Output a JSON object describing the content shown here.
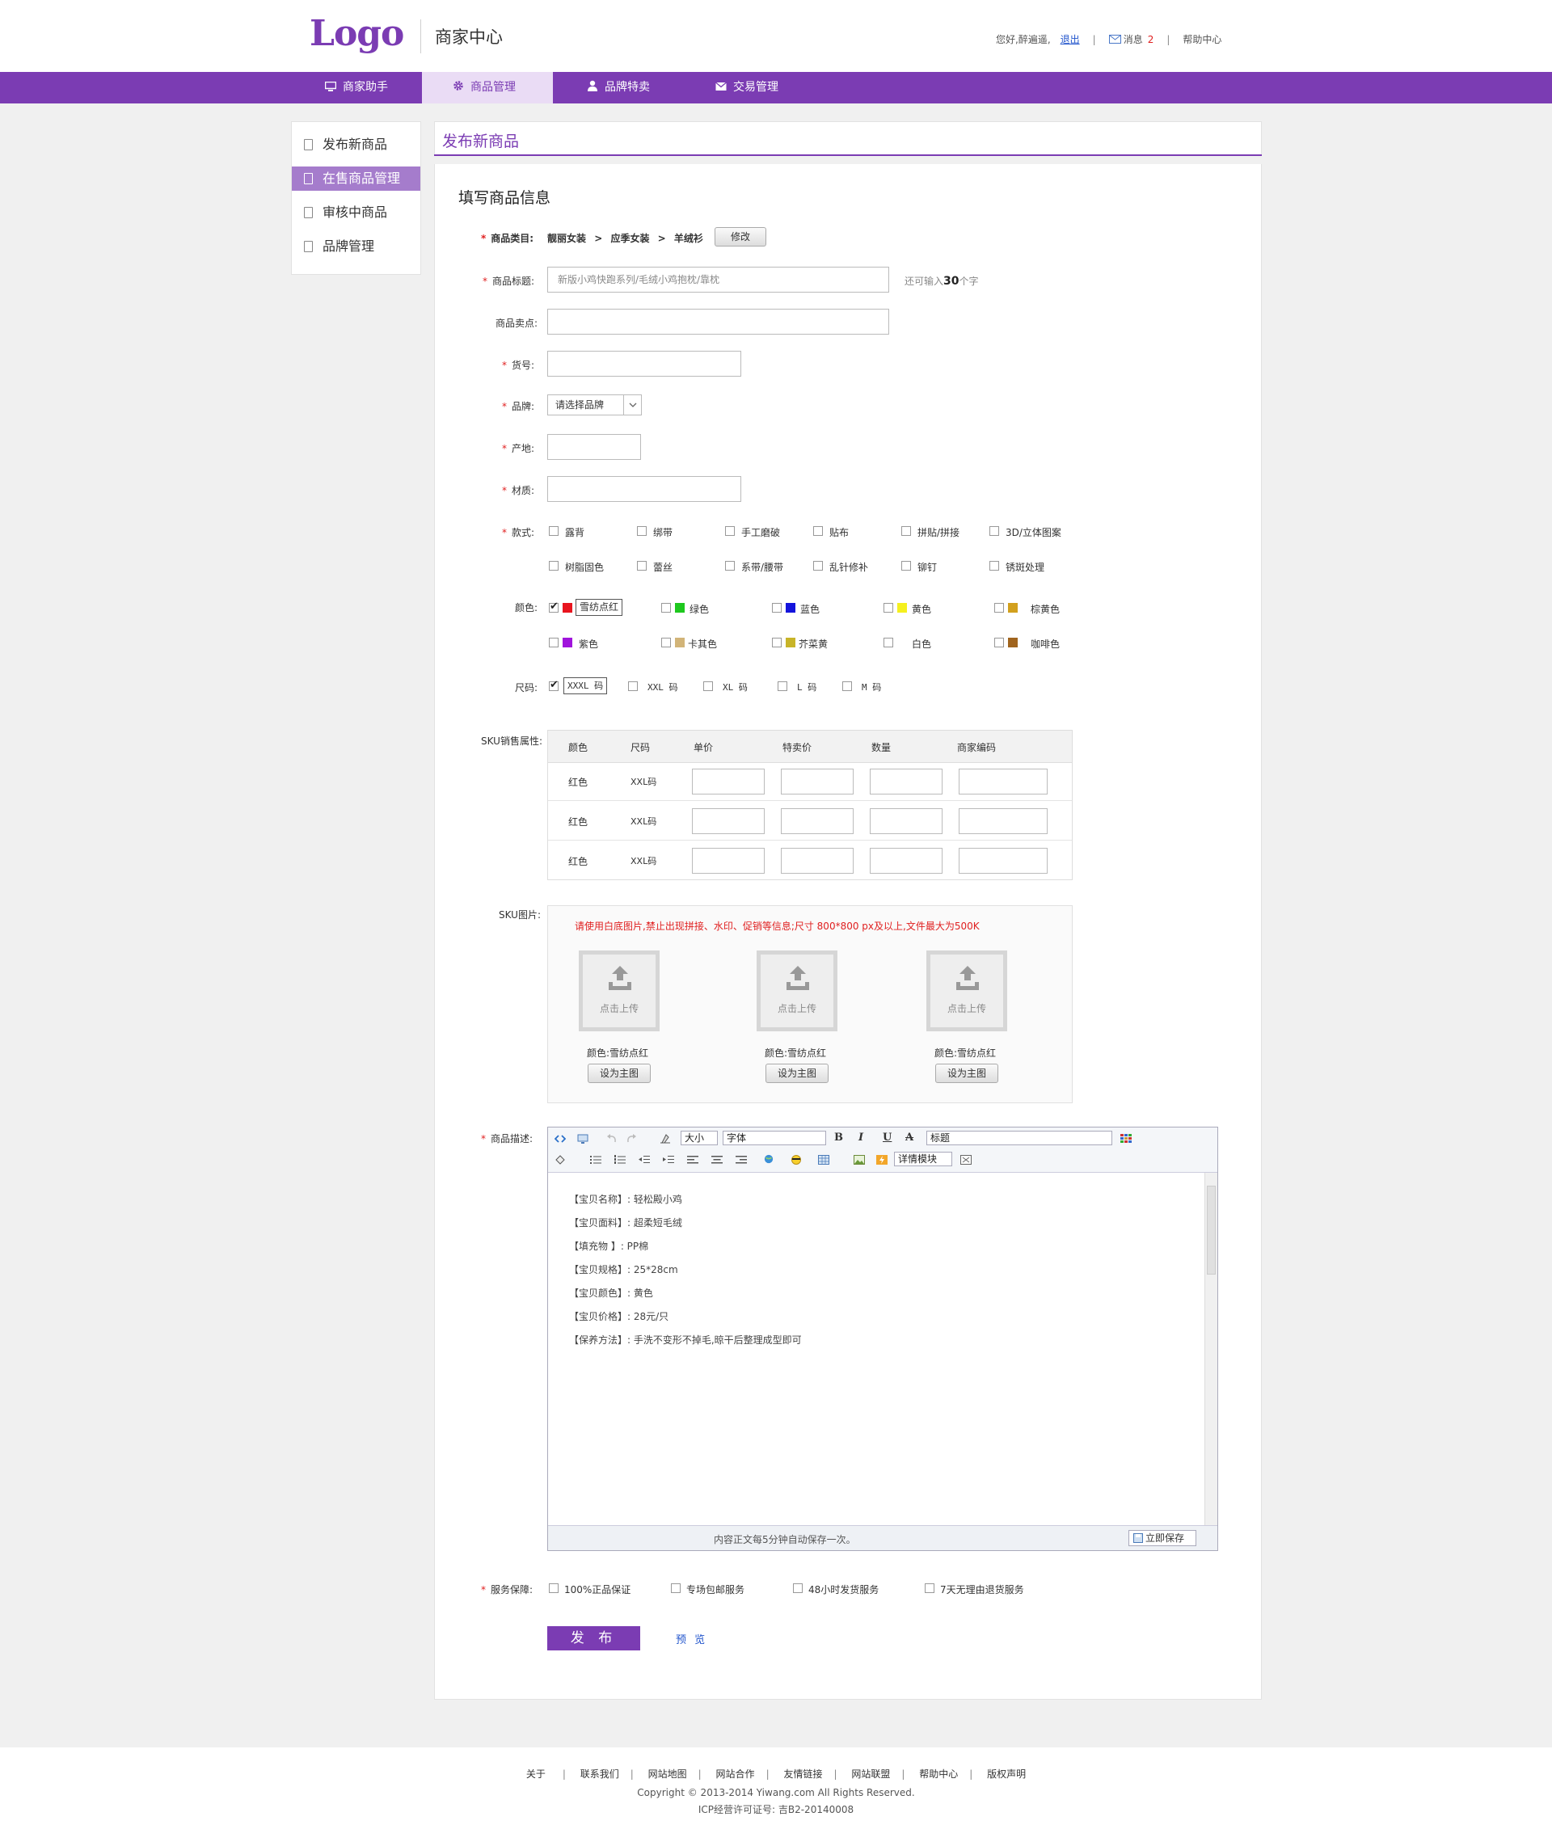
{
  "brand": {
    "logo": "Logo",
    "site_name": "商家中心"
  },
  "topbar": {
    "greeting": "您好,醉遍遥,",
    "logout": "退出",
    "messages_label": "消息",
    "messages_count": "2",
    "help": "帮助中心",
    "separator": "|"
  },
  "nav": {
    "items": [
      {
        "label": "商家助手",
        "icon": "monitor-icon"
      },
      {
        "label": "商品管理",
        "icon": "gear-icon"
      },
      {
        "label": "品牌特卖",
        "icon": "user-icon"
      },
      {
        "label": "交易管理",
        "icon": "mail-icon"
      }
    ],
    "active": "商品管理"
  },
  "sidebar": {
    "items": [
      {
        "label": "发布新商品"
      },
      {
        "label": "在售商品管理"
      },
      {
        "label": "审核中商品"
      },
      {
        "label": "品牌管理"
      }
    ],
    "active": "在售商品管理"
  },
  "main": {
    "title": "发布新商品",
    "subtitle": "填写商品信息"
  },
  "form": {
    "category": {
      "label": "商品类目:",
      "path": [
        "靓丽女装",
        "应季女装",
        "羊绒衫"
      ],
      "separator": ">",
      "modify_button": "修改"
    },
    "title": {
      "label": "商品标题:",
      "value": "新版小鸡快跑系列/毛绒小鸡抱枕/靠枕",
      "hint_prefix": "还可输入",
      "hint_count": "30",
      "hint_suffix": "个字"
    },
    "selling_point": {
      "label": "商品卖点:",
      "value": ""
    },
    "item_no": {
      "label": "货号:",
      "value": ""
    },
    "brand": {
      "label": "品牌:",
      "selected": "请选择品牌"
    },
    "origin": {
      "label": "产地:",
      "value": ""
    },
    "material": {
      "label": "材质:",
      "value": ""
    },
    "style": {
      "label": "款式:",
      "options": [
        {
          "label": "露背",
          "checked": false
        },
        {
          "label": "绑带",
          "checked": false
        },
        {
          "label": "手工磨破",
          "checked": false
        },
        {
          "label": "贴布",
          "checked": false
        },
        {
          "label": "拼贴/拼接",
          "checked": false
        },
        {
          "label": "3D/立体图案",
          "checked": false
        },
        {
          "label": "树脂固色",
          "checked": false
        },
        {
          "label": "蕾丝",
          "checked": false
        },
        {
          "label": "系带/腰带",
          "checked": false
        },
        {
          "label": "乱针修补",
          "checked": false
        },
        {
          "label": "铆钉",
          "checked": false
        },
        {
          "label": "锈斑处理",
          "checked": false
        }
      ]
    },
    "color": {
      "label": "颜色:",
      "options": [
        {
          "label": "雪纺点红",
          "swatch": "#e8141e",
          "checked": true
        },
        {
          "label": "绿色",
          "swatch": "#1ec81e",
          "checked": false
        },
        {
          "label": "蓝色",
          "swatch": "#1414dc",
          "checked": false
        },
        {
          "label": "黄色",
          "swatch": "#f5f01e",
          "checked": false
        },
        {
          "label": "棕黄色",
          "swatch": "#d2a01e",
          "checked": false
        },
        {
          "label": "紫色",
          "swatch": "#a014dc",
          "checked": false
        },
        {
          "label": "卡其色",
          "swatch": "#d2b478",
          "checked": false
        },
        {
          "label": "芥菜黄",
          "swatch": "#c8b428",
          "checked": false
        },
        {
          "label": "白色",
          "swatch": "#ffffff",
          "checked": false
        },
        {
          "label": "咖啡色",
          "swatch": "#a0641e",
          "checked": false
        }
      ]
    },
    "size": {
      "label": "尺码:",
      "options": [
        {
          "label": "XXXL 码",
          "checked": true
        },
        {
          "label": "XXL 码",
          "checked": false
        },
        {
          "label": "XL 码",
          "checked": false
        },
        {
          "label": "L 码",
          "checked": false
        },
        {
          "label": "M 码",
          "checked": false
        }
      ]
    },
    "sku": {
      "label": "SKU销售属性:",
      "headers": [
        "颜色",
        "尺码",
        "单价",
        "特卖价",
        "数量",
        "商家编码"
      ],
      "rows": [
        {
          "color": "红色",
          "size": "XXL码"
        },
        {
          "color": "红色",
          "size": "XXL码"
        },
        {
          "color": "红色",
          "size": "XXL码"
        }
      ]
    },
    "sku_images": {
      "label": "SKU图片:",
      "notice": "请使用白底图片,禁止出现拼接、水印、促销等信息;尺寸 800*800 px及以上,文件最大为500K",
      "upload_text": "点击上传",
      "items": [
        {
          "caption": "颜色:雪纺点红",
          "button": "设为主图"
        },
        {
          "caption": "颜色:雪纺点红",
          "button": "设为主图"
        },
        {
          "caption": "颜色:雪纺点红",
          "button": "设为主图"
        }
      ]
    },
    "description": {
      "label": "商品描述:",
      "toolbar": {
        "size_select": "大小",
        "font_select": "字体",
        "heading_select": "标题",
        "module_select": "详情模块",
        "bold": "B",
        "italic": "I",
        "underline": "U",
        "strike": "A"
      },
      "lines": [
        "【宝贝名称】: 轻松殿小鸡",
        "【宝贝面料】: 超柔短毛绒",
        "【填充物 】: PP棉",
        "【宝贝规格】: 25*28cm",
        "【宝贝颜色】: 黄色",
        "【宝贝价格】: 28元/只",
        "【保养方法】: 手洗不变形不掉毛,晾干后整理成型即可"
      ],
      "autosave": "内容正文每5分钟自动保存一次。",
      "save_button": "立即保存"
    },
    "service": {
      "label": "服务保障:",
      "options": [
        {
          "label": "100%正品保证",
          "checked": false
        },
        {
          "label": "专场包邮服务",
          "checked": false
        },
        {
          "label": "48小时发货服务",
          "checked": false
        },
        {
          "label": "7天无理由退货服务",
          "checked": false
        }
      ]
    },
    "publish_button": "发 布",
    "preview_link": "预 览"
  },
  "footer": {
    "links": [
      "关于",
      "联系我们",
      "网站地图",
      "网站合作",
      "友情链接",
      "网站联盟",
      "帮助中心",
      "版权声明"
    ],
    "copyright": "Copyright © 2013-2014 Yiwang.com All Rights Reserved.",
    "icp": "ICP经营许可证号: 吉B2-20140008"
  },
  "colors": {
    "accent": "#7b3cb3",
    "nav_active_bg": "#eadcf5",
    "sidebar_active_bg": "#a57ccc",
    "required": "#e02020",
    "link": "#2255cc"
  }
}
